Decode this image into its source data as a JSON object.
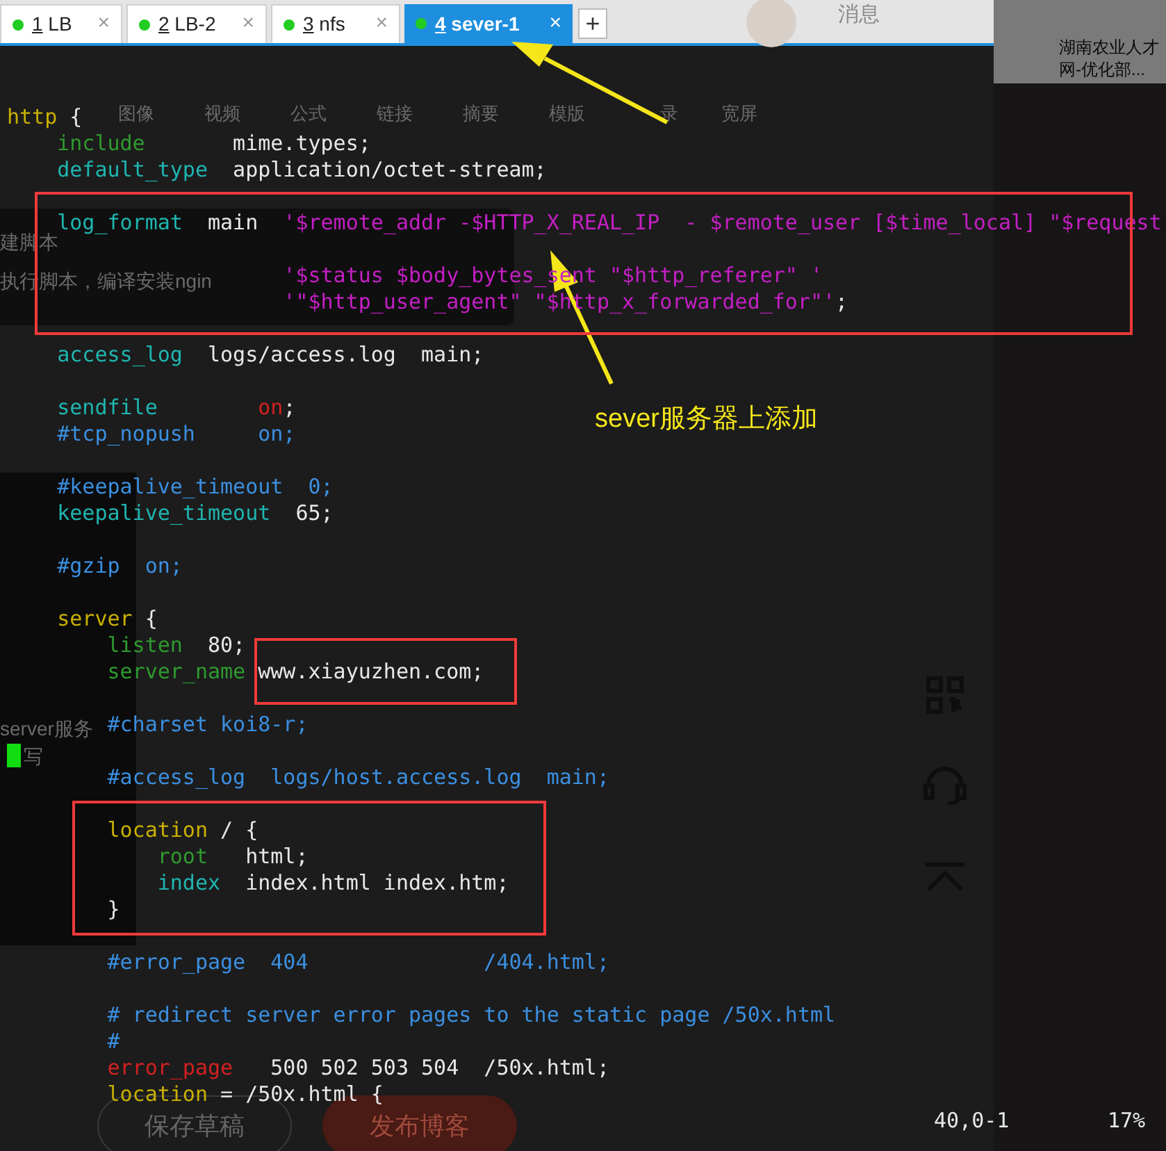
{
  "tabs": [
    {
      "number": "1",
      "label": "LB",
      "close": "×",
      "connected": true,
      "selected": false
    },
    {
      "number": "2",
      "label": "LB-2",
      "close": "×",
      "connected": true,
      "selected": false
    },
    {
      "number": "3",
      "label": "nfs",
      "close": "×",
      "connected": true,
      "selected": false
    },
    {
      "number": "4",
      "label": "sever-1",
      "close": "×",
      "connected": true,
      "selected": true
    }
  ],
  "new_tab": "+",
  "terminal": {
    "lines": [
      {
        "kind": "code",
        "segments": [
          {
            "text": "http",
            "color": "#c9b000"
          },
          {
            "text": " {",
            "color": "#e8e8e8"
          }
        ]
      },
      {
        "kind": "code",
        "segments": [
          {
            "text": "    include",
            "color": "#2f9a2f"
          },
          {
            "text": "       mime.types;",
            "color": "#e8e8e8"
          }
        ]
      },
      {
        "kind": "code",
        "segments": [
          {
            "text": "    default_type",
            "color": "#1fb5b0"
          },
          {
            "text": "  application/octet-stream;",
            "color": "#e8e8e8"
          }
        ]
      },
      {
        "kind": "blank"
      },
      {
        "kind": "code",
        "segments": [
          {
            "text": "    log_format",
            "color": "#1fb5b0"
          },
          {
            "text": "  main  ",
            "color": "#e8e8e8"
          },
          {
            "text": "'$remote_addr -$HTTP_X_REAL_IP  - $remote_user [$time_local] \"$request",
            "color": "#c41fc4"
          }
        ]
      },
      {
        "kind": "blank"
      },
      {
        "kind": "code",
        "segments": [
          {
            "text": "                      '$status $body_bytes_sent \"$http_referer\" '",
            "color": "#c41fc4"
          }
        ]
      },
      {
        "kind": "code",
        "segments": [
          {
            "text": "                      '\"$http_user_agent\" \"$http_x_forwarded_for\"'",
            "color": "#c41fc4"
          },
          {
            "text": ";",
            "color": "#e8e8e8"
          }
        ]
      },
      {
        "kind": "blank"
      },
      {
        "kind": "code",
        "segments": [
          {
            "text": "    access_log",
            "color": "#1fb5b0"
          },
          {
            "text": "  logs/access.log  main;",
            "color": "#e8e8e8"
          }
        ]
      },
      {
        "kind": "blank"
      },
      {
        "kind": "code",
        "segments": [
          {
            "text": "    sendfile        ",
            "color": "#1fb5b0"
          },
          {
            "text": "on",
            "color": "#d42020"
          },
          {
            "text": ";",
            "color": "#e8e8e8"
          }
        ]
      },
      {
        "kind": "code",
        "segments": [
          {
            "text": "    #tcp_nopush     on;",
            "color": "#3b8fe0"
          }
        ]
      },
      {
        "kind": "blank"
      },
      {
        "kind": "code",
        "segments": [
          {
            "text": "    #keepalive_timeout  0;",
            "color": "#3b8fe0"
          }
        ]
      },
      {
        "kind": "code",
        "segments": [
          {
            "text": "    keepalive_timeout",
            "color": "#1fb5b0"
          },
          {
            "text": "  65;",
            "color": "#e8e8e8"
          }
        ]
      },
      {
        "kind": "blank"
      },
      {
        "kind": "code",
        "segments": [
          {
            "text": "    #gzip  on;",
            "color": "#3b8fe0"
          }
        ]
      },
      {
        "kind": "blank"
      },
      {
        "kind": "code",
        "segments": [
          {
            "text": "    server",
            "color": "#c9b000"
          },
          {
            "text": " {",
            "color": "#e8e8e8"
          }
        ]
      },
      {
        "kind": "code",
        "segments": [
          {
            "text": "        listen",
            "color": "#2f9a2f"
          },
          {
            "text": "  80;",
            "color": "#e8e8e8"
          }
        ]
      },
      {
        "kind": "code",
        "segments": [
          {
            "text": "        server_name",
            "color": "#2f9a2f"
          },
          {
            "text": " www.xiayuzhen.com;",
            "color": "#e8e8e8"
          }
        ]
      },
      {
        "kind": "blank"
      },
      {
        "kind": "code",
        "segments": [
          {
            "text": "        #charset koi8-r;",
            "color": "#3b8fe0"
          }
        ]
      },
      {
        "kind": "blank"
      },
      {
        "kind": "code",
        "segments": [
          {
            "text": "        #access_log  logs/host.access.log  main;",
            "color": "#3b8fe0"
          }
        ]
      },
      {
        "kind": "blank"
      },
      {
        "kind": "code",
        "segments": [
          {
            "text": "        location",
            "color": "#c9b000"
          },
          {
            "text": " / {",
            "color": "#e8e8e8"
          }
        ]
      },
      {
        "kind": "code",
        "segments": [
          {
            "text": "            root",
            "color": "#2f9a2f"
          },
          {
            "text": "   html;",
            "color": "#e8e8e8"
          }
        ]
      },
      {
        "kind": "code",
        "segments": [
          {
            "text": "            index",
            "color": "#1fb5b0"
          },
          {
            "text": "  index.html index.htm;",
            "color": "#e8e8e8"
          }
        ]
      },
      {
        "kind": "code",
        "segments": [
          {
            "text": "        }",
            "color": "#e8e8e8"
          }
        ]
      },
      {
        "kind": "blank"
      },
      {
        "kind": "code",
        "segments": [
          {
            "text": "        #error_page  404              /404.html;",
            "color": "#3b8fe0"
          }
        ]
      },
      {
        "kind": "blank"
      },
      {
        "kind": "code",
        "segments": [
          {
            "text": "        # redirect server error pages to the static page /50x.html",
            "color": "#3b8fe0"
          }
        ]
      },
      {
        "kind": "code",
        "segments": [
          {
            "text": "        #",
            "color": "#3b8fe0"
          }
        ]
      },
      {
        "kind": "code",
        "segments": [
          {
            "text": "        error_page",
            "color": "#d42020"
          },
          {
            "text": "   500 502 503 504  /50x.html;",
            "color": "#e8e8e8"
          }
        ]
      },
      {
        "kind": "code",
        "segments": [
          {
            "text": "        location",
            "color": "#c9b000"
          },
          {
            "text": " = /50x.html {",
            "color": "#e8e8e8"
          }
        ]
      }
    ],
    "status": {
      "position": "40,0-1",
      "scroll": "17%"
    }
  },
  "annotation": {
    "label": "sever服务器上添加"
  },
  "background_page": {
    "header": {
      "messages": "消息",
      "article_title": [
        "湖南农业人才",
        "网-优化部..."
      ]
    },
    "toolbar": [
      "图像",
      "视频",
      "公式",
      "链接",
      "摘要",
      "模版",
      "录",
      "宽屏"
    ],
    "editor_lines": [
      "建脚本",
      "执行脚本，编译安装ngin",
      "server服务",
      "写"
    ],
    "buttons": [
      "保存草稿",
      "发布博客"
    ]
  }
}
